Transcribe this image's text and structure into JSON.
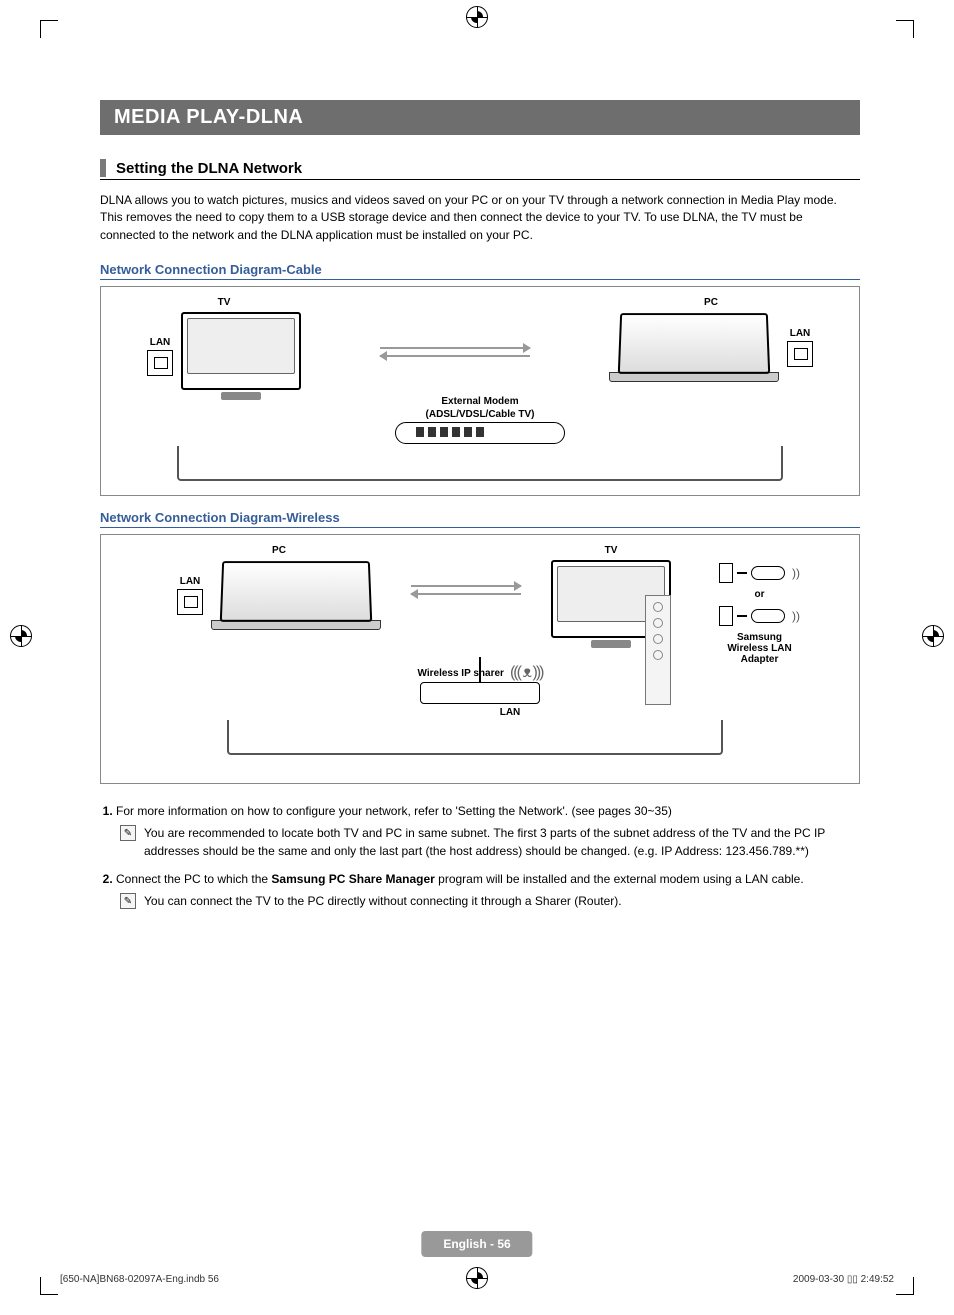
{
  "banner": "MEDIA PLAY-DLNA",
  "section_title": "Setting the DLNA Network",
  "intro": "DLNA allows you to watch pictures, musics and videos saved on your PC or on your TV through a network connection in Media Play mode. This removes the need to copy them to a USB storage device and then connect the device to your TV. To use DLNA, the TV must be connected to the network and the DLNA application must be installed on your PC.",
  "diagram1": {
    "title": "Network Connection Diagram-Cable",
    "tv_label": "TV",
    "pc_label": "PC",
    "lan_label_left": "LAN",
    "lan_label_right": "LAN",
    "modem_label_1": "External Modem",
    "modem_label_2": "(ADSL/VDSL/Cable TV)"
  },
  "diagram2": {
    "title": "Network Connection Diagram-Wireless",
    "pc_label": "PC",
    "tv_label": "TV",
    "lan_label": "LAN",
    "router_label": "Wireless IP sharer",
    "router_lan_label": "LAN",
    "or_label": "or",
    "adapter_label_1": "Samsung",
    "adapter_label_2": "Wireless LAN",
    "adapter_label_3": "Adapter"
  },
  "steps": {
    "s1": "For more information on how to configure your network, refer to 'Setting the Network'. (see pages 30~35)",
    "s1_note": "You are recommended to locate both TV and PC in same subnet. The first 3 parts of the subnet address of the TV and the PC IP addresses should be the same and only the last part (the host address) should be changed. (e.g. IP Address: 123.456.789.**)",
    "s2_pre": "Connect the PC to which the ",
    "s2_bold": "Samsung PC Share Manager",
    "s2_post": " program will be installed and the external modem using a LAN cable.",
    "s2_note": "You can connect the TV to the PC directly without connecting it through a Sharer (Router)."
  },
  "footer": {
    "page_label": "English - 56",
    "file_ref": "[650-NA]BN68-02097A-Eng.indb   56",
    "timestamp": "2009-03-30   ▯▯ 2:49:52"
  }
}
